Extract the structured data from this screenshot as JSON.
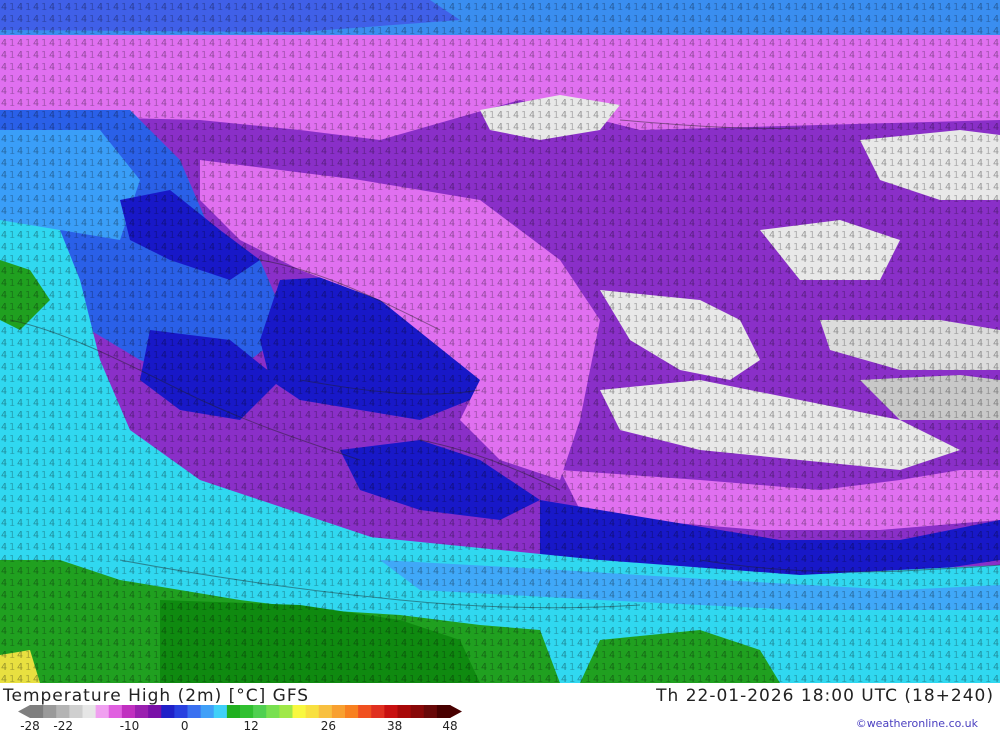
{
  "header": {
    "title": "Temperature High (2m) [°C] GFS",
    "valid_time": "Th 22-01-2026 18:00 UTC (18+240)"
  },
  "legend": {
    "tick_labels": [
      "-28",
      "-22",
      "-10",
      "0",
      "12",
      "26",
      "38",
      "48"
    ],
    "tick_values": [
      -28,
      -22,
      -10,
      0,
      12,
      26,
      38,
      48
    ],
    "range": [
      -28,
      48
    ],
    "colors": [
      "#7f7f7f",
      "#9a9a9a",
      "#b4b4b4",
      "#cfcfcf",
      "#e6e6e6",
      "#f0a0f0",
      "#e060e0",
      "#c030c0",
      "#9a20b0",
      "#7a10a8",
      "#2020c8",
      "#2840e0",
      "#3a70f0",
      "#40a0f8",
      "#40d0f8",
      "#20b020",
      "#30c030",
      "#50d050",
      "#78e050",
      "#a0e848",
      "#f8f840",
      "#f8e040",
      "#f8c040",
      "#f8a030",
      "#f88020",
      "#f05020",
      "#e03020",
      "#c81010",
      "#a80808",
      "#880808",
      "#680808",
      "#480000"
    ]
  },
  "footer": {
    "copyright": "©weatheronline.co.uk"
  },
  "map": {
    "region": "Europe / Russia temperature field",
    "palette": {
      "very_cold": "#e8e8e8",
      "cold_purple": "#8a2fc8",
      "pink": "#e070f0",
      "blue": "#2020d0",
      "light_blue": "#3aa0f8",
      "cyan": "#30e0f0",
      "green": "#20a020"
    }
  }
}
